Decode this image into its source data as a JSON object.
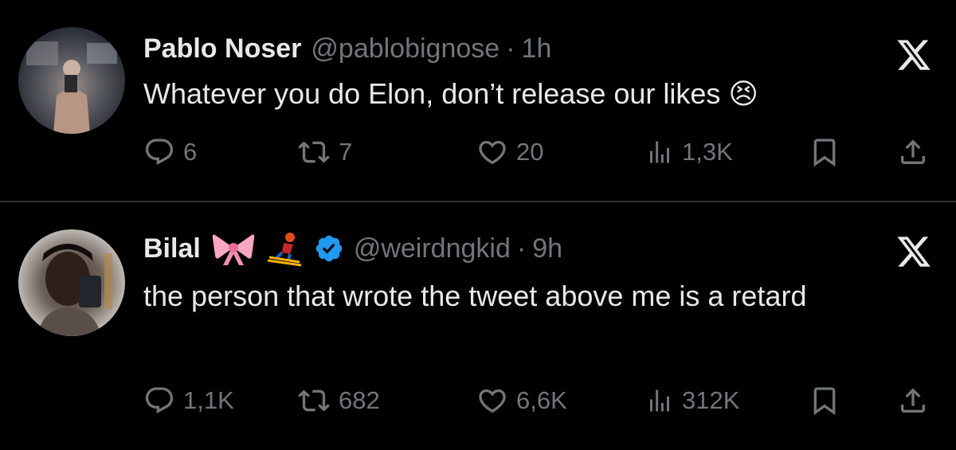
{
  "tweets": [
    {
      "name": "Pablo Noser",
      "handle": "@pablobignose",
      "separator": "·",
      "time": "1h",
      "text": "Whatever you do Elon, don’t release our likes 😣",
      "stats": {
        "replies": "6",
        "reposts": "7",
        "likes": "20",
        "views": "1,3K"
      }
    },
    {
      "name": "Bilal",
      "handle": "@weirdngkid",
      "separator": "·",
      "time": "9h",
      "name_decorations": [
        "🎀",
        "⛷️"
      ],
      "verified": true,
      "text": "the person that wrote the tweet above me is a retard",
      "stats": {
        "replies": "1,1K",
        "reposts": "682",
        "likes": "6,6K",
        "views": "312K"
      }
    }
  ],
  "colors": {
    "background": "#000000",
    "text": "#e7e9ea",
    "muted": "#71767b",
    "verified": "#1d9bf0",
    "divider": "#2f3336"
  },
  "icons": [
    "x-logo-icon",
    "reply-icon",
    "repost-icon",
    "like-icon",
    "views-icon",
    "bookmark-icon",
    "share-icon",
    "verified-badge-icon"
  ]
}
